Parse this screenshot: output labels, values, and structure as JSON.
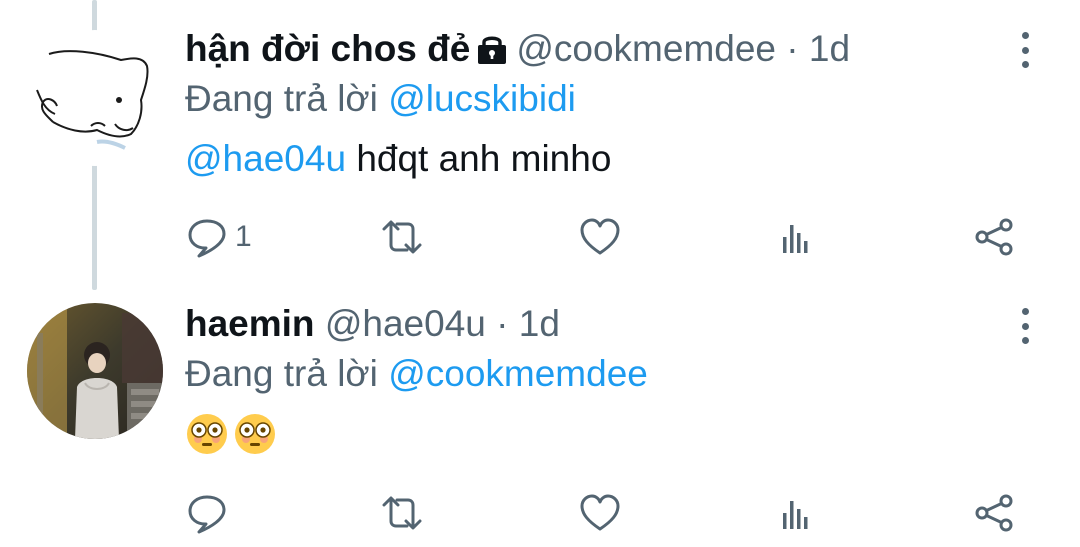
{
  "tweets": [
    {
      "author_name": "hận đời chos đẻ",
      "protected": true,
      "handle": "@cookmemdee",
      "time": "1d",
      "replying_prefix": "Đang trả lời",
      "replying_to": "@lucskibidi",
      "mention": "@hae04u",
      "text": "hđqt anh minho",
      "reply_count": "1"
    },
    {
      "author_name": "haemin",
      "handle": "@hae04u",
      "time": "1d",
      "replying_prefix": "Đang trả lời",
      "replying_to": "@cookmemdee",
      "text_emojis": [
        "flushed-face",
        "flushed-face"
      ]
    }
  ],
  "separator": "·",
  "icons": [
    "reply-icon",
    "retweet-icon",
    "like-icon",
    "views-icon",
    "share-icon",
    "more-options-icon",
    "lock-icon"
  ],
  "colors": {
    "accent": "#1d9bf0",
    "secondary_text": "#536471",
    "primary_text": "#0f1419",
    "thread_line": "#cfd9de"
  }
}
